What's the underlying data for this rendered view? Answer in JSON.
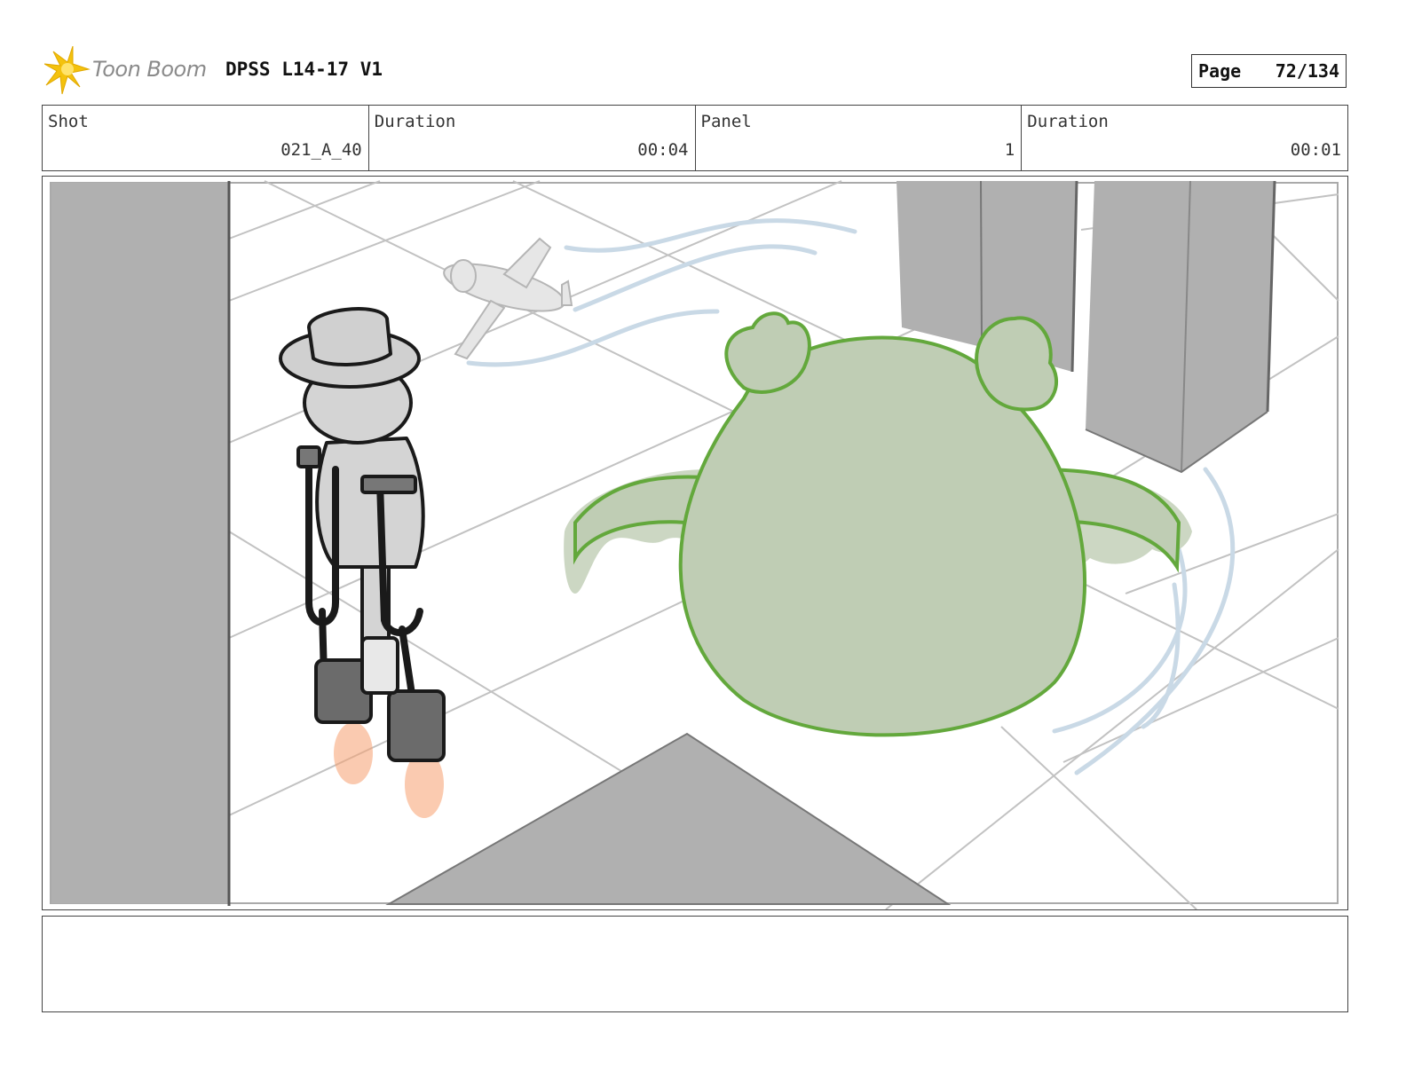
{
  "header": {
    "logo_text": "Toon Boom",
    "title": "DPSS L14-17 V1",
    "page_label": "Page",
    "page_number": "72/134"
  },
  "info": {
    "shot_label": "Shot",
    "shot_value": "021_A_40",
    "duration_label": "Duration",
    "duration_value": "00:04",
    "panel_label": "Panel",
    "panel_value": "1",
    "panel_duration_label": "Duration",
    "panel_duration_value": "00:01"
  },
  "notes": {
    "text": ""
  },
  "colors": {
    "logo_yellow": "#f4c20d",
    "pillar_gray": "#b0b0b0",
    "ghost_green": "#bfcdb4",
    "ghost_outline": "#63a83c",
    "wind_blue": "#c9d9e6",
    "jet_orange": "#f7a070"
  }
}
